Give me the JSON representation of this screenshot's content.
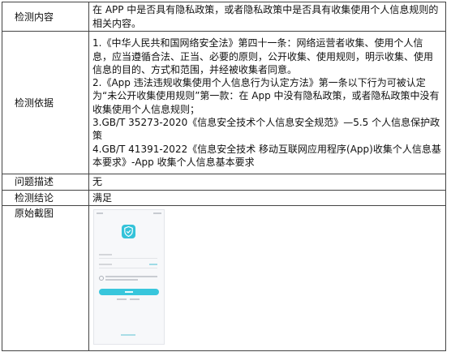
{
  "rows": {
    "content": {
      "label": "检测内容",
      "value": "在 APP 中是否具有隐私政策，或者隐私政策中是否具有收集使用个人信息规则的相关内容。"
    },
    "basis": {
      "label": "检测依据",
      "items": [
        "1.《中华人民共和国网络安全法》第四十一条：网络运营者收集、使用个人信息，应当遵循合法、正当、必要的原则，公开收集、使用规则，明示收集、使用信息的目的、方式和范围，并经被收集者同意。",
        "2.《App 违法违规收集使用个人信息行为认定方法》第一条以下行为可被认定为“未公开收集使用规则”第一款：在 App 中没有隐私政策，或者隐私政策中没有收集使用个人信息规则；",
        "3.GB/T 35273-2020《信息安全技术个人信息安全规范》—5.5 个人信息保护政策",
        "4.GB/T 41391-2022《信息安全技术 移动互联网应用程序(App)收集个人信息基本要求》-App 收集个人信息基本要求"
      ]
    },
    "issue": {
      "label": "问题描述",
      "value": "无"
    },
    "conclusion": {
      "label": "检测结论",
      "value": "满足"
    },
    "screenshot": {
      "label": "原始截图"
    }
  },
  "screenshot_colors": {
    "accent": "#38c6dc",
    "background": "#f7f8fa"
  }
}
